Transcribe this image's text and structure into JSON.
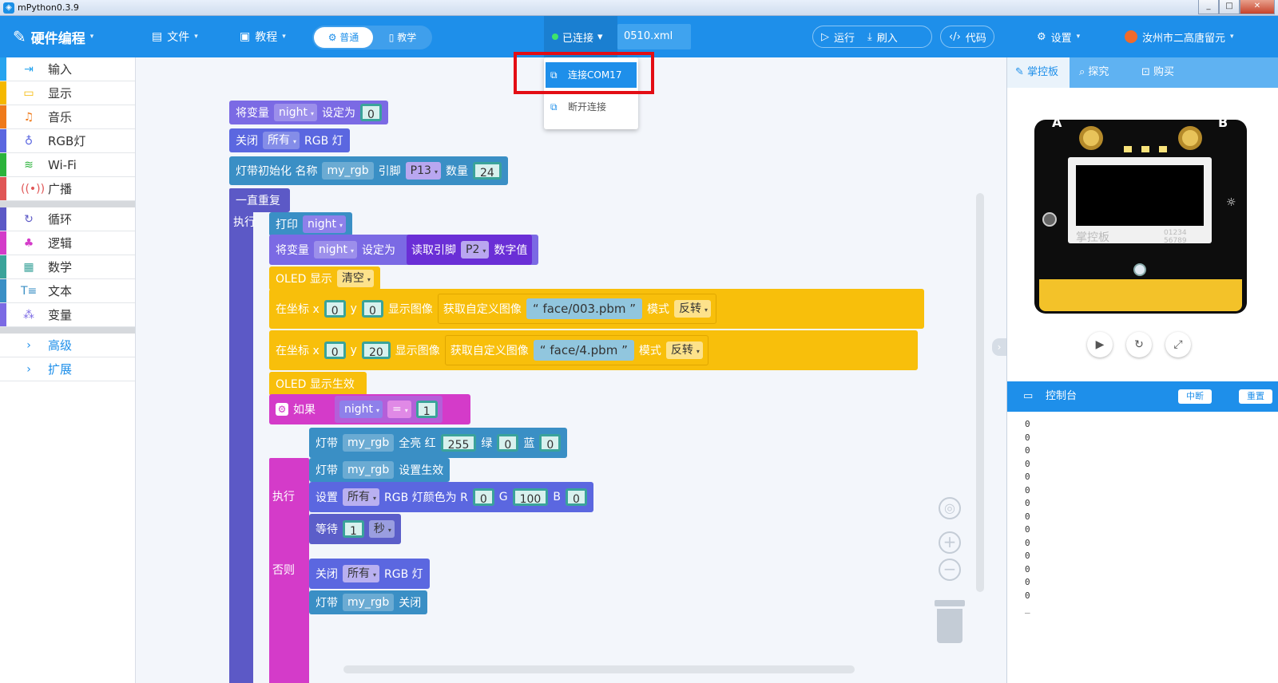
{
  "window": {
    "title": "mPython0.3.9",
    "min": "_",
    "max": "□",
    "close": "✕"
  },
  "toolbar": {
    "app_name": "硬件编程",
    "file_label": "文件",
    "tutorial_label": "教程",
    "mode_normal": "普通",
    "mode_teach": "教学",
    "connection_status": "已连接",
    "filename": "0510.xml",
    "run_label": "运行",
    "flash_label": "刷入",
    "code_label": "代码",
    "settings_label": "设置",
    "user_name": "汝州市二高唐留元"
  },
  "connect_menu": {
    "items": [
      "连接COM17",
      "断开连接"
    ]
  },
  "sidebar": {
    "items": [
      {
        "label": "输入",
        "icon": "input-icon",
        "color": "#27a4ef"
      },
      {
        "label": "显示",
        "icon": "display-icon",
        "color": "#f5b800"
      },
      {
        "label": "音乐",
        "icon": "music-icon",
        "color": "#ef7a1a"
      },
      {
        "label": "RGB灯",
        "icon": "bulb-icon",
        "color": "#5b67e0"
      },
      {
        "label": "Wi-Fi",
        "icon": "wifi-icon",
        "color": "#2bb33b"
      },
      {
        "label": "广播",
        "icon": "broadcast-icon",
        "color": "#e05656"
      },
      {
        "label": "循环",
        "icon": "loop-icon",
        "color": "#5c59c6"
      },
      {
        "label": "逻辑",
        "icon": "logic-icon",
        "color": "#d43bc9"
      },
      {
        "label": "数学",
        "icon": "math-icon",
        "color": "#3aa39a"
      },
      {
        "label": "文本",
        "icon": "text-icon",
        "color": "#3a8fc5"
      },
      {
        "label": "变量",
        "icon": "variable-icon",
        "color": "#7b6ae4"
      },
      {
        "label": "高级",
        "icon": "chevron-right-icon",
        "color": "#1e8fea"
      },
      {
        "label": "扩展",
        "icon": "chevron-right-icon",
        "color": "#1e8fea"
      }
    ]
  },
  "blocks": {
    "set_var": "将变量",
    "var_night": "night",
    "set_to": "设定为",
    "zero": "0",
    "close": "关闭",
    "all": "所有",
    "rgb_light": "RGB 灯",
    "strip_init": "灯带初始化 名称",
    "strip_name": "my_rgb",
    "pin_word": "引脚",
    "pin_p13": "P13",
    "count_word": "数量",
    "count_24": "24",
    "forever": "一直重复",
    "do": "执行",
    "print": "打印",
    "read_pin": "读取引脚",
    "pin_p2": "P2",
    "digital": "数字值",
    "oled_show": "OLED 显示",
    "clear": "清空",
    "at_xy": "在坐标 x",
    "y": "y",
    "show_image": "显示图像",
    "get_image": "获取自定义图像",
    "img1": "face/003.pbm",
    "img2": "face/4.pbm",
    "mode": "模式",
    "invert": "反转",
    "y20": "20",
    "oled_apply": "OLED 显示生效",
    "if": "如果",
    "eq": "=",
    "one": "1",
    "strip": "灯带",
    "full_red": "全亮 红",
    "red_255": "255",
    "green": "绿",
    "blue": "蓝",
    "strip_apply": "设置生效",
    "set": "设置",
    "rgb_color_r": "RGB 灯颜色为 R",
    "g": "G",
    "g100": "100",
    "b": "B",
    "wait": "等待",
    "sec": "秒",
    "else": "否则",
    "rgb": "RGB 灯",
    "off": "关闭"
  },
  "right_panel": {
    "tab_board": "掌控板",
    "tab_explore": "探究",
    "tab_buy": "购买",
    "board_brand": "掌控板",
    "board_code": "01234 56789",
    "board_a": "A",
    "board_b": "B",
    "console_title": "控制台",
    "interrupt": "中断",
    "reset": "重置",
    "console_lines": [
      "0",
      "0",
      "0",
      "0",
      "0",
      "0",
      "0",
      "0",
      "0",
      "0",
      "0",
      "0",
      "0",
      "0",
      "_"
    ]
  }
}
